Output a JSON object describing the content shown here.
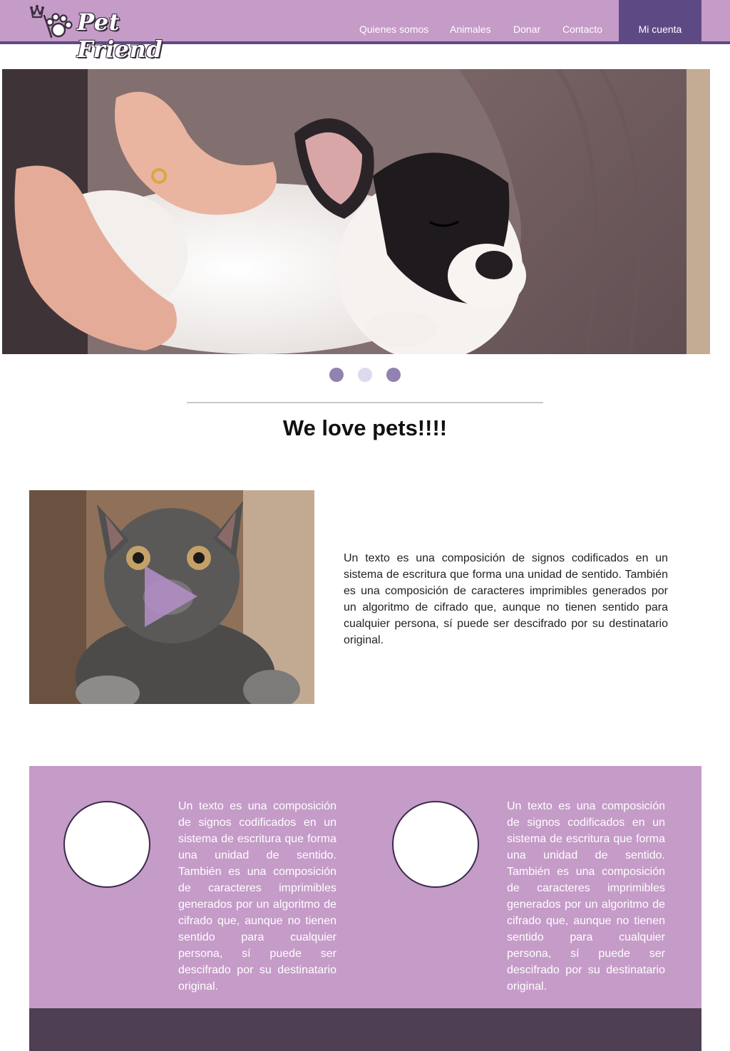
{
  "header": {
    "brand": "Pet Friend",
    "nav": [
      {
        "label": "Quienes somos"
      },
      {
        "label": "Animales"
      },
      {
        "label": "Donar"
      },
      {
        "label": "Contacto"
      }
    ],
    "account_label": "Mi cuenta"
  },
  "carousel": {
    "slide_count": 3,
    "active_index": 2,
    "dot_colors": [
      "#9182b0",
      "#dcdaec",
      "#9182b0"
    ]
  },
  "headline": "We love pets!!!!",
  "intro": {
    "text": "Un texto es una composición de signos codificados en un sistema de escritura que forma una unidad de sentido. También es una composición de caracteres imprimibles generados por un algoritmo de cifrado que, aunque no tienen sentido para cualquier persona, sí puede ser descifrado por su destinatario original."
  },
  "features": [
    {
      "text": "Un texto es una composición de signos codificados en un sistema de escritura que forma una unidad de sentido. También es una composición de caracteres imprimibles generados por un algoritmo de cifrado que, aunque no tienen sentido para cualquier persona, sí puede ser descifrado por su destinatario original."
    },
    {
      "text": "Un texto es una composición de signos codificados en un sistema de escritura que forma una unidad de sentido. También es una composición de caracteres imprimibles generados por un algoritmo de cifrado que, aunque no tienen sentido para cualquier persona, sí puede ser descifrado por su destinatario original."
    }
  ],
  "colors": {
    "header": "#c59bc8",
    "accent": "#5d4a85",
    "feature_band": "#c59bc8",
    "footer": "#4f3f52"
  }
}
